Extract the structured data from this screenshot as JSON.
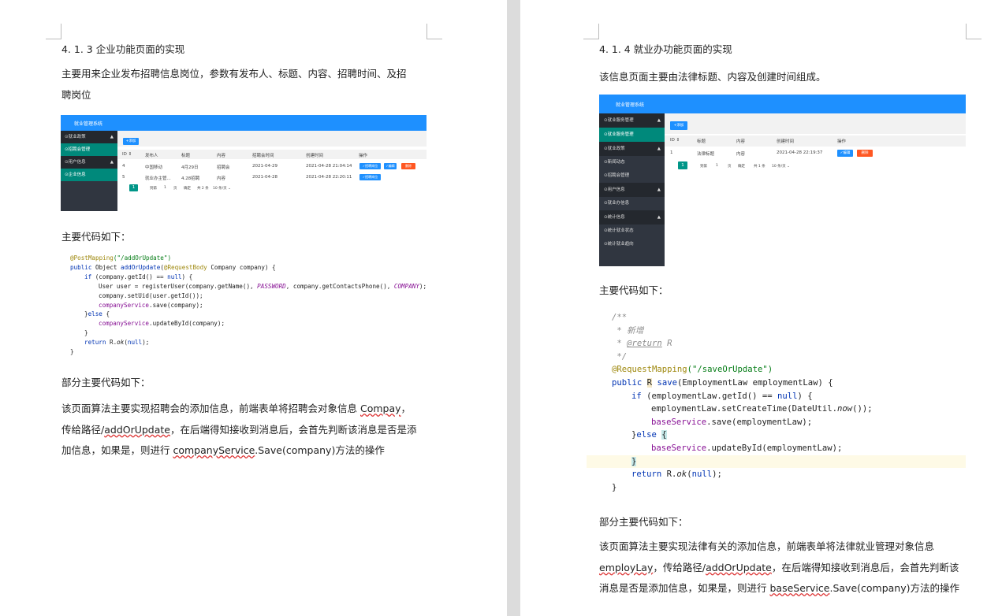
{
  "left": {
    "heading": "4. 1. 3 企业功能页面的实现",
    "intro_line1": "主要用来企业发布招聘信息岗位，参数有发布人、标题、内容、招聘时间、及招",
    "intro_line2": "聘岗位",
    "shot": {
      "app_title": "就业管理系统",
      "menu": [
        "⊙就业政策",
        "⊙招聘会管理",
        "⊙用户信息",
        "⊙企业信息"
      ],
      "add_btn": "+添加",
      "columns": [
        "ID ⇕",
        "发布人",
        "标题",
        "内容",
        "招聘会时间",
        "创建时间",
        "操作"
      ],
      "rows": [
        [
          "4",
          "中国移动",
          "4月29日",
          "招聘会",
          "2021-04-29",
          "2021-04-28 21:04:14"
        ],
        [
          "5",
          "就业办主管...",
          "4.28招聘",
          "内容",
          "2021-04-28",
          "2021-04-28 22:20:11"
        ]
      ],
      "edit_label": "✓招聘岗位",
      "edit2_label": "✓编辑",
      "delete_label": "删除",
      "pager": {
        "page": "1",
        "goto": "到第",
        "page_input": "1",
        "page_unit": "页",
        "confirm": "确定",
        "total": "共 2 条",
        "size": "10 条/页 ⌄"
      }
    },
    "code_heading": "主要代码如下：",
    "code": {
      "l1_ann": "@PostMapping",
      "l1_str": "(\"/addOrUpdate\")",
      "l2_kw": "public",
      "l2_a": " Object ",
      "l2_fn": "addOrUpdate",
      "l2_b": "(",
      "l2_ann": "@RequestBody",
      "l2_c": " Company company) {",
      "l3_kw": "if",
      "l3_a": " (company.getId() == ",
      "l3_null": "null",
      "l3_b": ") {",
      "l4_a": "User user = registerUser(company.getName(), ",
      "l4_f1": "PASSWORD",
      "l4_b": ", company.getContactsPhone(), ",
      "l4_f2": "COMPANY",
      "l4_c": ");",
      "l5": "company.setUid(user.getId());",
      "l6_f": "companyService",
      "l6_a": ".save(company);",
      "l7_a": "}",
      "l7_kw": "else",
      "l7_b": " {",
      "l8_f": "companyService",
      "l8_a": ".updateById(company);",
      "l9": "}",
      "l10_kw": "return",
      "l10_a": " R.",
      "l10_it": "ok",
      "l10_b": "(",
      "l10_null": "null",
      "l10_c": ");",
      "l11": "}"
    },
    "part_heading": "部分主要代码如下：",
    "desc1_a": "该页面算法主要实现招聘会的添加信息，前端表单将招聘会对象信息 ",
    "desc1_u": "Compay",
    "desc1_b": "，",
    "desc2_a": "传给路径/",
    "desc2_u": "addOrUpdate",
    "desc2_b": "，在后端得知接收到消息后，会首先判断该消息是否是添",
    "desc3_a": "加信息，如果是，则进行 ",
    "desc3_u": "companyService",
    "desc3_b": ".Save(company)方法的操作"
  },
  "right": {
    "heading": "4. 1. 4 就业办功能页面的实现",
    "intro": "该信息页面主要由法律标题、内容及创建时间组成。",
    "shot": {
      "app_title": "就业管理系统",
      "menu": [
        {
          "label": "⊙就业服务管理",
          "type": "grp"
        },
        {
          "label": "⊙就业服务管理",
          "type": "act"
        },
        {
          "label": "⊙就业政策",
          "type": "grp"
        },
        {
          "label": "⊙新闻动态",
          "type": "item"
        },
        {
          "label": "⊙招聘会管理",
          "type": "item"
        },
        {
          "label": "⊙用户信息",
          "type": "grp"
        },
        {
          "label": "⊙就业办信息",
          "type": "item"
        },
        {
          "label": "⊙统计信息",
          "type": "grp"
        },
        {
          "label": "⊙统计就业状态",
          "type": "item"
        },
        {
          "label": "⊙统计就业趋向",
          "type": "item"
        }
      ],
      "add_btn": "+添加",
      "columns": [
        "ID ⇕",
        "标题",
        "内容",
        "创建时间",
        "操作"
      ],
      "row": [
        "1",
        "法律标题",
        "内容",
        "2021-04-28 22:19:37"
      ],
      "edit_label": "✓编辑",
      "delete_label": "删除",
      "pager": {
        "page": "1",
        "goto": "到第",
        "page_input": "1",
        "page_unit": "页",
        "confirm": "确定",
        "total": "共 1 条",
        "size": "10 条/页 ⌄"
      }
    },
    "code_heading": "主要代码如下：",
    "code": {
      "c1": "/**",
      "c2": " * 新增",
      "c3_a": " * ",
      "c3_u": "@return",
      "c3_b": " R",
      "c4": " */",
      "m_ann": "@RequestMapping",
      "m_str": "(\"/saveOrUpdate\")",
      "s_kw": "public",
      "s_r": "R",
      "s_fn": "save",
      "s_rest": "(EmploymentLaw employmentLaw) {",
      "i_kw": "if",
      "i_a": " (employmentLaw.getId() == ",
      "i_null": "null",
      "i_b": ") {",
      "e1_a": "employmentLaw.setCreateTime(DateUtil.",
      "e1_it": "now",
      "e1_b": "());",
      "e2_f": "baseService",
      "e2_a": ".save(employmentLaw);",
      "e3_a": "}",
      "e3_kw": "else",
      "e3_b": " ",
      "e3_br": "{",
      "e4_f": "baseService",
      "e4_a": ".updateById(employmentLaw);",
      "e5": "}",
      "r_kw": "return",
      "r_a": " R.",
      "r_it": "ok",
      "r_b": "(",
      "r_null": "null",
      "r_c": ");",
      "end": "}"
    },
    "part_heading": "部分主要代码如下：",
    "desc1": "该页面算法主要实现法律有关的添加信息，前端表单将法律就业管理对象信息",
    "desc2_u": "employLay",
    "desc2_a": "，传给路径/",
    "desc2_u2": "addOrUpdate",
    "desc2_b": "，在后端得知接收到消息后，会首先判断该",
    "desc3_a": "消息是否是添加信息，如果是，则进行 ",
    "desc3_u": "baseService",
    "desc3_b": ".Save(company)方法的操作"
  },
  "colors": {
    "accent": "#1e90ff",
    "sidebar": "#303640",
    "active": "#00897b",
    "delete": "#ff5722"
  }
}
